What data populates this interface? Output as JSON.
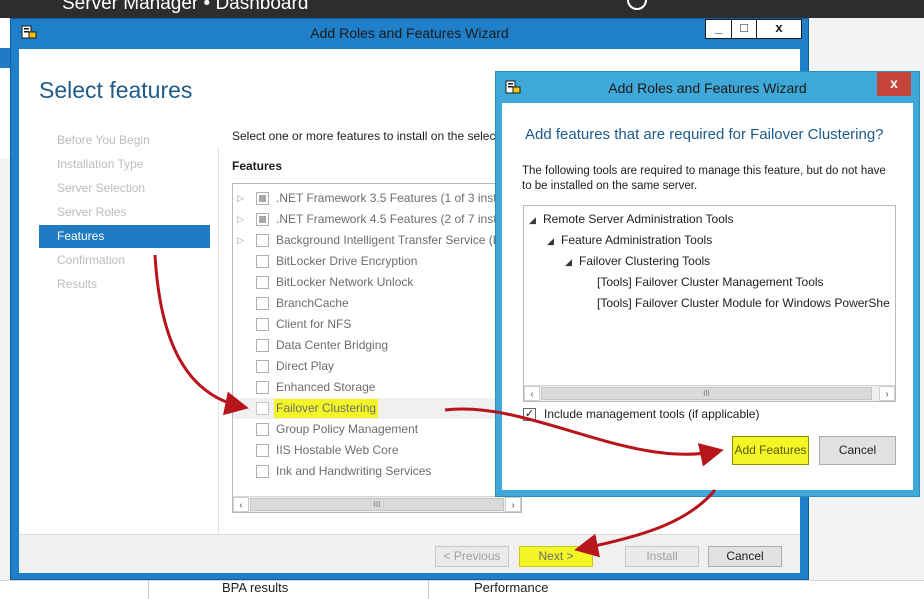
{
  "background_app": {
    "title": "Server Manager • Dashboard",
    "bottom_items": [
      "BPA results",
      "Performance"
    ]
  },
  "main_wizard": {
    "window_title": "Add Roles and Features Wizard",
    "caption_buttons": [
      "_",
      "□",
      "x"
    ],
    "heading": "Select features",
    "steps": [
      {
        "label": "Before You Begin",
        "state": "disabled"
      },
      {
        "label": "Installation Type",
        "state": "disabled"
      },
      {
        "label": "Server Selection",
        "state": "disabled"
      },
      {
        "label": "Server Roles",
        "state": "disabled"
      },
      {
        "label": "Features",
        "state": "active"
      },
      {
        "label": "Confirmation",
        "state": "disabled"
      },
      {
        "label": "Results",
        "state": "disabled"
      }
    ],
    "instructions": "Select one or more features to install on the selec",
    "features_label": "Features",
    "features": [
      {
        "label": ".NET Framework 3.5 Features (1 of 3 insta",
        "expandable": true,
        "check": "partial"
      },
      {
        "label": ".NET Framework 4.5 Features (2 of 7 insta",
        "expandable": true,
        "check": "partial"
      },
      {
        "label": "Background Intelligent Transfer Service (B",
        "expandable": true,
        "check": "none"
      },
      {
        "label": "BitLocker Drive Encryption",
        "expandable": false,
        "check": "none"
      },
      {
        "label": "BitLocker Network Unlock",
        "expandable": false,
        "check": "none"
      },
      {
        "label": "BranchCache",
        "expandable": false,
        "check": "none"
      },
      {
        "label": "Client for NFS",
        "expandable": false,
        "check": "none"
      },
      {
        "label": "Data Center Bridging",
        "expandable": false,
        "check": "none"
      },
      {
        "label": "Direct Play",
        "expandable": false,
        "check": "none"
      },
      {
        "label": "Enhanced Storage",
        "expandable": false,
        "check": "none"
      },
      {
        "label": "Failover Clustering",
        "expandable": false,
        "check": "none",
        "highlighted": true
      },
      {
        "label": "Group Policy Management",
        "expandable": false,
        "check": "none"
      },
      {
        "label": "IIS Hostable Web Core",
        "expandable": false,
        "check": "none"
      },
      {
        "label": "Ink and Handwriting Services",
        "expandable": false,
        "check": "none"
      }
    ],
    "scroll_thumb": "III",
    "buttons": {
      "previous": "< Previous",
      "next": "Next >",
      "install": "Install",
      "cancel": "Cancel"
    }
  },
  "dialog": {
    "window_title": "Add Roles and Features Wizard",
    "close": "x",
    "heading": "Add features that are required for Failover Clustering?",
    "description": "The following tools are required to manage this feature, but do not have to be installed on the same server.",
    "tree": [
      {
        "label": "Remote Server Administration Tools",
        "level": 0,
        "expanded": true
      },
      {
        "label": "Feature Administration Tools",
        "level": 1,
        "expanded": true
      },
      {
        "label": "Failover Clustering Tools",
        "level": 2,
        "expanded": true
      },
      {
        "label": "[Tools] Failover Cluster Management Tools",
        "level": 3,
        "expanded": false
      },
      {
        "label": "[Tools] Failover Cluster Module for Windows PowerShe",
        "level": 3,
        "expanded": false
      }
    ],
    "scroll_thumb": "III",
    "include_checked": true,
    "include_label": "Include management tools (if applicable)",
    "buttons": {
      "add": "Add Features",
      "cancel": "Cancel"
    }
  },
  "colors": {
    "window_frame": "#1f7fc8",
    "dialog_frame": "#3ea8d8",
    "accent_blue": "#1e7bc4",
    "highlight_yellow": "#f4f527",
    "annotation_arrow": "#b8141b"
  }
}
